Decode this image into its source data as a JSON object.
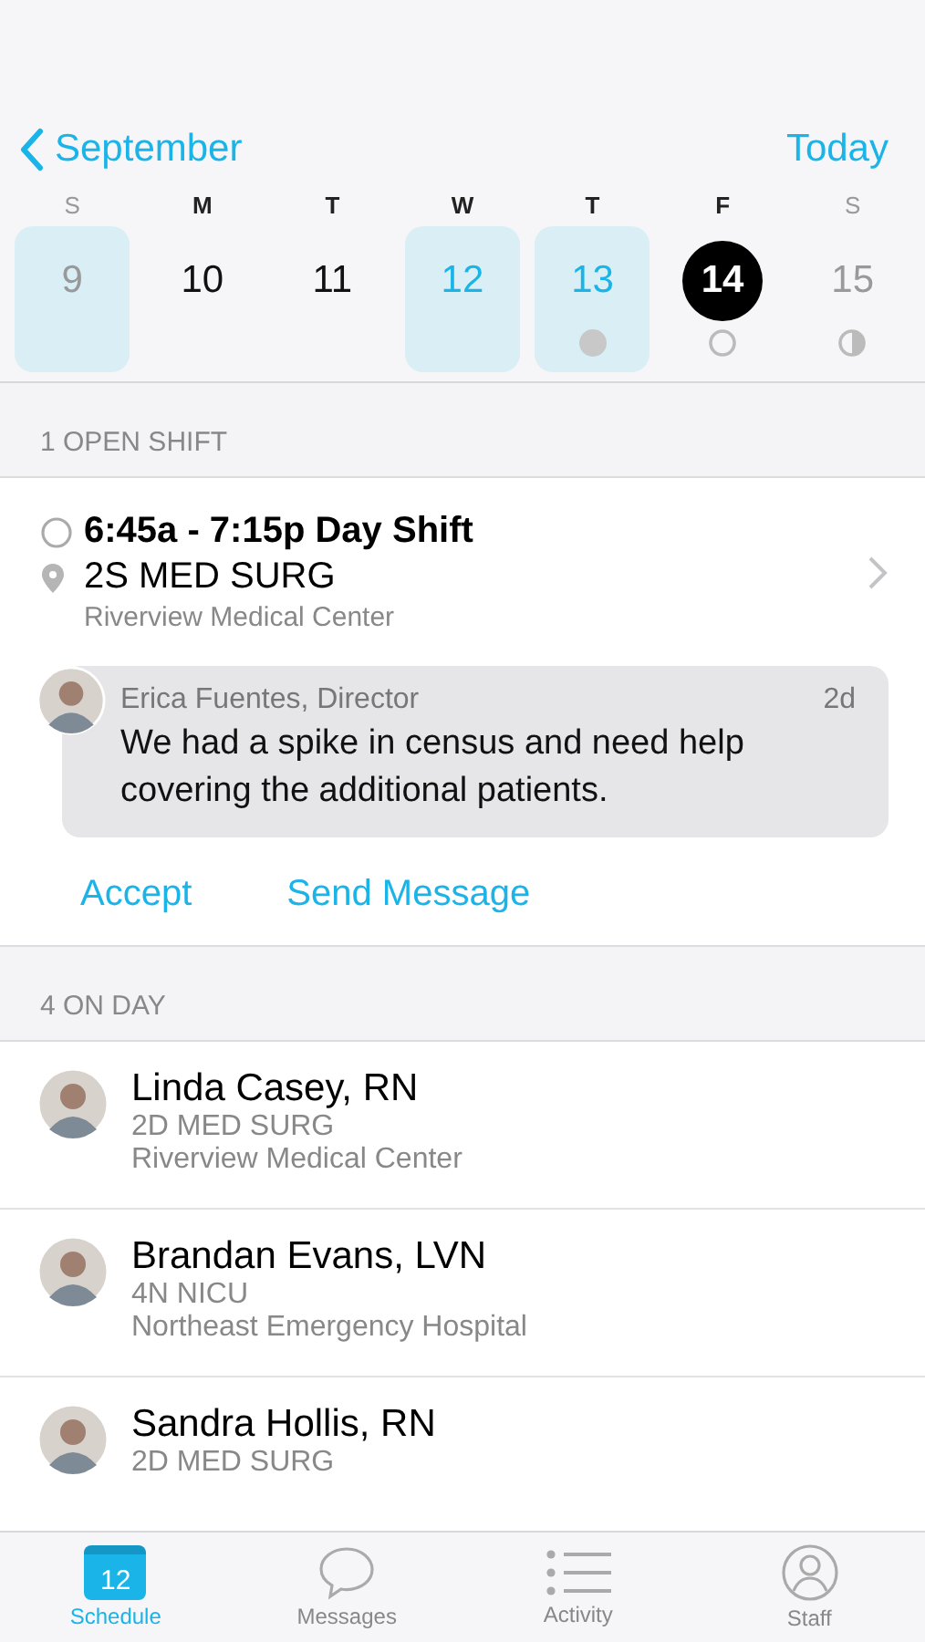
{
  "nav": {
    "back_label": "September",
    "action": "Today"
  },
  "week": [
    {
      "weekday": "S",
      "day": "9",
      "highlighted": true,
      "selected": false,
      "dimmed": true
    },
    {
      "weekday": "M",
      "day": "10",
      "highlighted": false,
      "selected": false,
      "dimmed": false
    },
    {
      "weekday": "T",
      "day": "11",
      "highlighted": false,
      "selected": false,
      "dimmed": false
    },
    {
      "weekday": "W",
      "day": "12",
      "highlighted": true,
      "selected": false,
      "dimmed": false
    },
    {
      "weekday": "T",
      "day": "13",
      "highlighted": true,
      "selected": false,
      "dimmed": false,
      "kind": "filled"
    },
    {
      "weekday": "F",
      "day": "14",
      "highlighted": false,
      "selected": true,
      "dimmed": false,
      "kind": "empty"
    },
    {
      "weekday": "S",
      "day": "15",
      "highlighted": false,
      "selected": false,
      "dimmed": true,
      "kind": "half"
    }
  ],
  "open_shifts": {
    "header": "1 OPEN SHIFT",
    "shift": {
      "time": "6:45a - 7:15p Day Shift",
      "unit": "2S MED SURG",
      "facility": "Riverview Medical Center"
    },
    "message": {
      "author": "Erica Fuentes, Director",
      "age": "2d",
      "text": "We had a spike in census and need help covering the additional patients."
    },
    "actions": [
      "Accept",
      "Send Message"
    ]
  },
  "on_day": {
    "header": "4 ON DAY",
    "people": [
      {
        "name": "Linda Casey, RN",
        "unit": "2D MED SURG",
        "facility": "Riverview Medical Center"
      },
      {
        "name": "Brandan Evans, LVN",
        "unit": "4N NICU",
        "facility": "Northeast Emergency Hospital"
      },
      {
        "name": "Sandra Hollis, RN",
        "unit": "2D MED SURG"
      }
    ]
  },
  "tab_bar": [
    {
      "label": "Schedule",
      "kind": "calendar",
      "badge": "12",
      "selected": true
    },
    {
      "label": "Messages",
      "kind": "bubble",
      "selected": false
    },
    {
      "label": "Activity",
      "kind": "list",
      "selected": false
    },
    {
      "label": "Staff",
      "kind": "person",
      "selected": false
    }
  ]
}
